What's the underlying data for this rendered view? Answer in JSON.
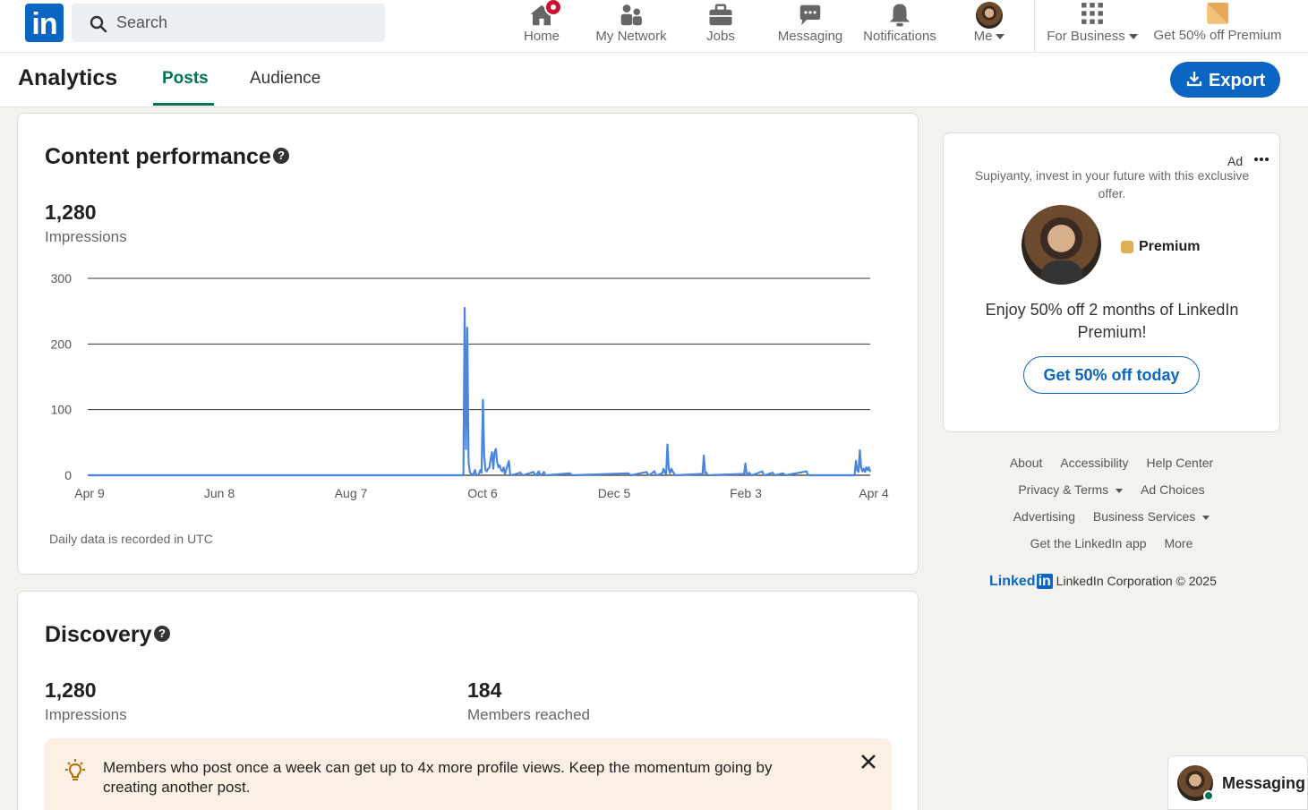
{
  "nav": {
    "search_placeholder": "Search",
    "items": [
      {
        "label": "Home"
      },
      {
        "label": "My Network"
      },
      {
        "label": "Jobs"
      },
      {
        "label": "Messaging"
      },
      {
        "label": "Notifications"
      },
      {
        "label": "Me"
      },
      {
        "label": "For Business"
      },
      {
        "label": "Get 50% off Premium"
      }
    ]
  },
  "subheader": {
    "title": "Analytics",
    "tabs": [
      "Posts",
      "Audience"
    ],
    "export_label": "Export"
  },
  "content_performance": {
    "title": "Content performance",
    "help": "?",
    "value": "1,280",
    "metric": "Impressions",
    "note": "Daily data is recorded in UTC"
  },
  "chart_data": {
    "type": "line",
    "title": "",
    "xlabel": "",
    "ylabel": "",
    "ylim": [
      0,
      300
    ],
    "yticks": [
      0,
      100,
      200,
      300
    ],
    "xtick_labels": [
      "Apr 9",
      "Jun 8",
      "Aug 7",
      "Oct 6",
      "Dec 5",
      "Feb 3",
      "Apr 4"
    ],
    "grid": true,
    "color": "#4a86e0",
    "series": [
      {
        "x": [
          0,
          289,
          290,
          291,
          292,
          293,
          294,
          295,
          296,
          297,
          298,
          299,
          300,
          301,
          302,
          303,
          304,
          305,
          306,
          307,
          308,
          309,
          310,
          311,
          312,
          313,
          314,
          315,
          316,
          317,
          318,
          319,
          320,
          321,
          324,
          325,
          326,
          333,
          334,
          335,
          343,
          344,
          345,
          347,
          348,
          349,
          351,
          352,
          353,
          371,
          372,
          373,
          416,
          417,
          418,
          430,
          431,
          432,
          436,
          437,
          438,
          442,
          443,
          444,
          445,
          446,
          447,
          448,
          449,
          450,
          451,
          452,
          473,
          474,
          475,
          476,
          477,
          505,
          506,
          507,
          509,
          510,
          511,
          519,
          520,
          521,
          527,
          528,
          529,
          535,
          536,
          537,
          553,
          554,
          555,
          590,
          591,
          592,
          593,
          594,
          595,
          596,
          597,
          598,
          599,
          600,
          601,
          602
        ],
        "y": [
          0,
          0,
          255,
          40,
          225,
          20,
          5,
          2,
          0,
          3,
          8,
          0,
          0,
          2,
          8,
          4,
          115,
          30,
          8,
          6,
          10,
          12,
          25,
          35,
          10,
          35,
          40,
          20,
          12,
          15,
          8,
          6,
          12,
          2,
          22,
          2,
          0,
          4,
          1,
          0,
          5,
          1,
          0,
          6,
          1,
          0,
          5,
          1,
          0,
          3,
          1,
          0,
          3,
          1,
          0,
          5,
          1,
          0,
          6,
          1,
          0,
          3,
          10,
          4,
          2,
          47,
          10,
          3,
          10,
          6,
          3,
          0,
          2,
          30,
          3,
          4,
          0,
          2,
          18,
          0,
          4,
          1,
          0,
          6,
          1,
          0,
          4,
          1,
          0,
          3,
          1,
          0,
          6,
          1,
          0,
          0,
          22,
          8,
          5,
          38,
          12,
          6,
          10,
          5,
          12,
          8,
          12,
          5
        ]
      }
    ]
  },
  "discovery": {
    "title": "Discovery",
    "help": "?",
    "impressions_value": "1,280",
    "impressions_label": "Impressions",
    "members_value": "184",
    "members_label": "Members reached",
    "tip": "Members who post once a week can get up to 4x more profile views. Keep the momentum going by creating another post."
  },
  "ad": {
    "label": "Ad",
    "text": "Supiyanty, invest in your future with this exclusive offer.",
    "premium": "Premium",
    "headline": "Enjoy 50% off 2 months of LinkedIn Premium!",
    "cta": "Get 50% off today"
  },
  "footer": {
    "row1": [
      "About",
      "Accessibility",
      "Help Center"
    ],
    "row2": [
      "Privacy & Terms",
      "Ad Choices"
    ],
    "row3": [
      "Advertising",
      "Business Services"
    ],
    "row4": [
      "Get the LinkedIn app",
      "More"
    ],
    "logo": "Linked",
    "logo_in": "in",
    "copyright": "LinkedIn Corporation © 2025"
  },
  "messaging": {
    "label": "Messaging"
  },
  "icons": {
    "logo": "linkedin-logo",
    "search": "search-icon",
    "home": "home-icon",
    "network": "people-icon",
    "jobs": "briefcase-icon",
    "messaging": "chat-icon",
    "notifications": "bell-icon",
    "business": "grid-icon",
    "premium": "premium-icon",
    "export": "download-icon",
    "help": "help-icon",
    "tip": "lightbulb-icon",
    "close": "close-icon",
    "more": "more-icon"
  }
}
